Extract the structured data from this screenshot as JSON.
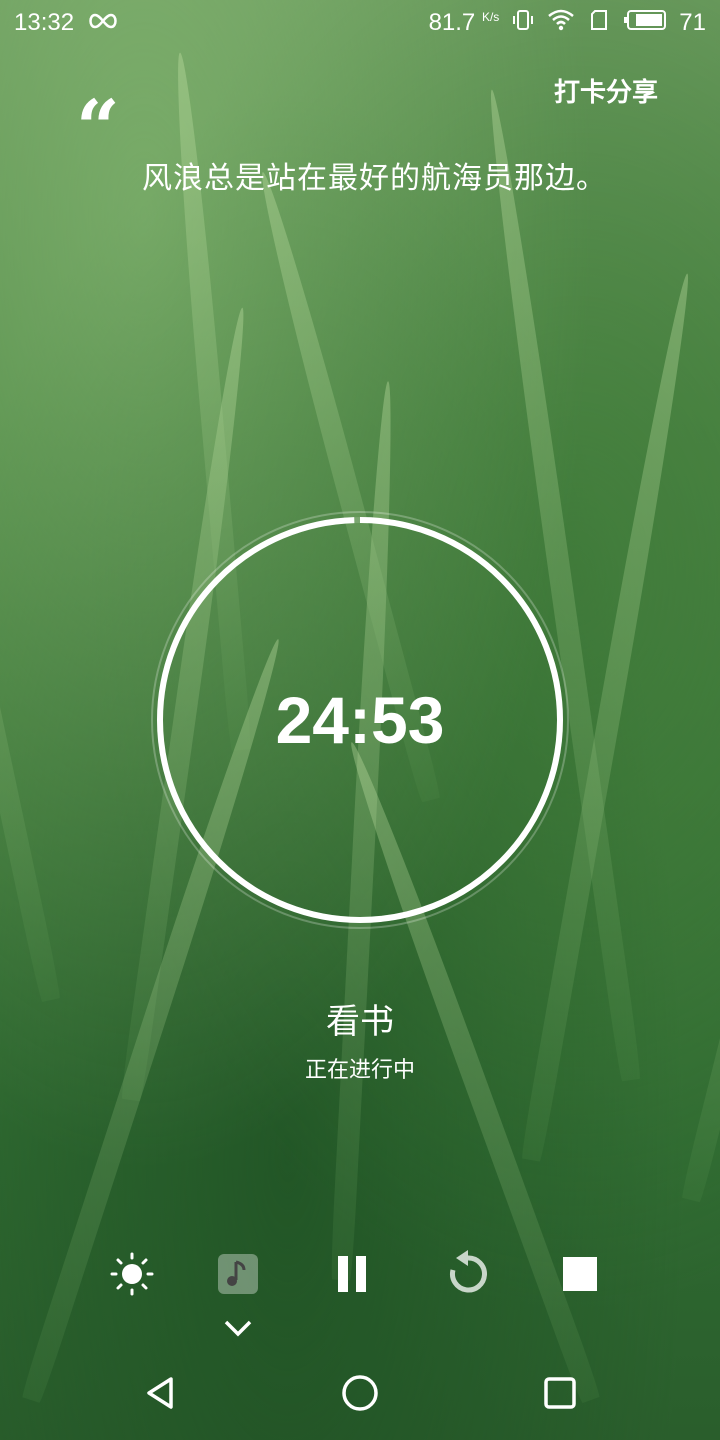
{
  "status_bar": {
    "time": "13:32",
    "network_speed": "81.7",
    "network_unit": "K/s",
    "battery": "71"
  },
  "header": {
    "share_label": "打卡分享"
  },
  "quote": {
    "mark": "“",
    "text": "风浪总是站在最好的航海员那边。"
  },
  "timer": {
    "value": "24:53",
    "progress": 0.995
  },
  "task": {
    "name": "看书",
    "status": "正在进行中"
  },
  "controls": {
    "icons": [
      "brightness-icon",
      "music-icon",
      "pause-icon",
      "reset-icon",
      "stop-icon"
    ]
  },
  "colors": {
    "accent": "#ffffff",
    "background": "#4e8745"
  }
}
